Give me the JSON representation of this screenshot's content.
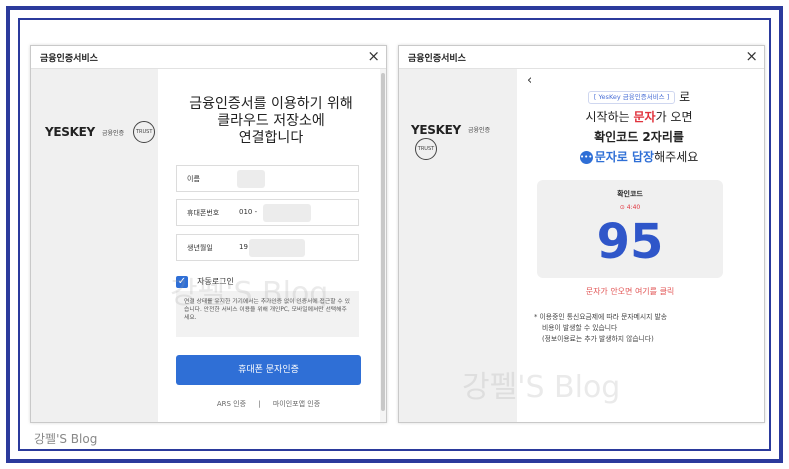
{
  "left_dialog": {
    "title": "금융인증서비스",
    "close_icon": "×",
    "logo": {
      "brand": "YESKEY",
      "sub": "금융인증",
      "badge": "TRUST"
    },
    "heading": [
      "금융인증서를 이용하기 위해",
      "클라우드 저장소에",
      "연결합니다"
    ],
    "fields": [
      {
        "label": "이름",
        "value": ""
      },
      {
        "label": "휴대폰번호",
        "value": "010 -"
      },
      {
        "label": "생년월일",
        "value": "19"
      }
    ],
    "auto_login_label": "자동로그인",
    "notice": "연결 상태를 유지한 기기에서는 추가인증 없이 인증서에 접근할 수 있습니다. 안전한 서비스 이용을 위해 개인PC, 모바일에서만 선택해주세요.",
    "primary_button": "휴대폰 문자인증",
    "links": [
      "ARS 인증",
      "|",
      "마이인포앱 인증"
    ]
  },
  "right_dialog": {
    "title": "금융인증서비스",
    "close_icon": "×",
    "back_icon": "‹",
    "logo": {
      "brand": "YESKEY",
      "sub": "금융인증",
      "badge": "TRUST"
    },
    "brand_pill": "[ YesKey 금융인증서비스 ]",
    "msg_line1_suffix": "로",
    "msg_line2_prefix": "시작하는 ",
    "msg_line2_highlight": "문자",
    "msg_line2_suffix": "가 오면",
    "msg_line3": "확인코드 2자리를",
    "msg_line4_highlight": "문자로 답장",
    "msg_line4_suffix": "해주세요",
    "code_title": "확인코드",
    "timer": "4:40",
    "code": "95",
    "resend_link": "문자가 안오면 여기를 클릭",
    "footnote": [
      "* 이용중인 통신요금제에 따라 문자메시지 발송",
      "비용이 발생할 수 있습니다",
      "(정보이용료는 추가 발생하지 않습니다)"
    ]
  },
  "watermark": "강펠'S Blog",
  "blog_label": "강펠'S Blog",
  "colors": {
    "frame": "#2b3a9c",
    "accent": "#2f6fd6",
    "code": "#2f56c9",
    "alert": "#e0323c"
  }
}
